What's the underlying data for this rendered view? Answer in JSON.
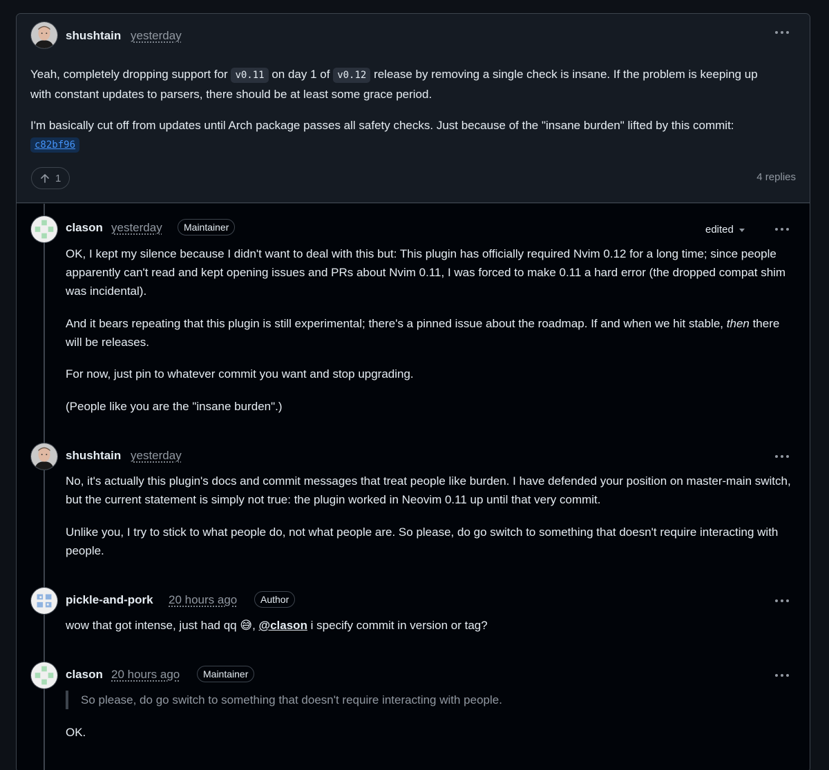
{
  "top_comment": {
    "author": "shushtain",
    "time": "yesterday",
    "para1_a": "Yeah, completely dropping support for ",
    "para1_code1": "v0.11",
    "para1_b": " on day 1 of ",
    "para1_code2": "v0.12",
    "para1_c": " release by removing a single check is insane. If the problem is keeping up with constant updates to parsers, there should be at least some grace period.",
    "para2_a": "I'm basically cut off from updates until Arch package passes all safety checks. Just because of the \"insane burden\" lifted by this commit: ",
    "para2_commit": "c82bf96",
    "upvotes": "1",
    "replies": "4 replies"
  },
  "reply1": {
    "author": "clason",
    "time": "yesterday",
    "role": "Maintainer",
    "edited": "edited",
    "para1": "OK, I kept my silence because I didn't want to deal with this but: This plugin has officially required Nvim 0.12 for a long time; since people apparently can't read and kept opening issues and PRs about Nvim 0.11, I was forced to make 0.11 a hard error (the dropped compat shim was incidental).",
    "para2_a": "And it bears repeating that this plugin is still experimental; there's a pinned issue about the roadmap. If and when we hit stable, ",
    "para2_em": "then",
    "para2_b": " there will be releases.",
    "para3": "For now, just pin to whatever commit you want and stop upgrading.",
    "para4": "(People like you are the \"insane burden\".)"
  },
  "reply2": {
    "author": "shushtain",
    "time": "yesterday",
    "para1": "No, it's actually this plugin's docs and commit messages that treat people like burden. I have defended your position on master-main switch, but the current statement is simply not true: the plugin worked in Neovim 0.11 up until that very commit.",
    "para2": "Unlike you, I try to stick to what people do, not what people are. So please, do go switch to something that doesn't require interacting with people."
  },
  "reply3": {
    "author": "pickle-and-pork",
    "time": "20 hours ago",
    "role": "Author",
    "text_a": "wow that got intense, just had qq ",
    "emoji": "😅",
    "text_b": ", ",
    "mention": "@clason",
    "text_c": " i specify commit in version or tag?"
  },
  "reply4": {
    "author": "clason",
    "time": "20 hours ago",
    "role": "Maintainer",
    "quote": "So please, do go switch to something that doesn't require interacting with people.",
    "text": "OK."
  },
  "colors": {
    "background": "#0d1117",
    "card": "#151b23",
    "replies_bg": "#010409",
    "link": "#4493f8",
    "muted": "#9198a1",
    "border": "#3d444d"
  }
}
